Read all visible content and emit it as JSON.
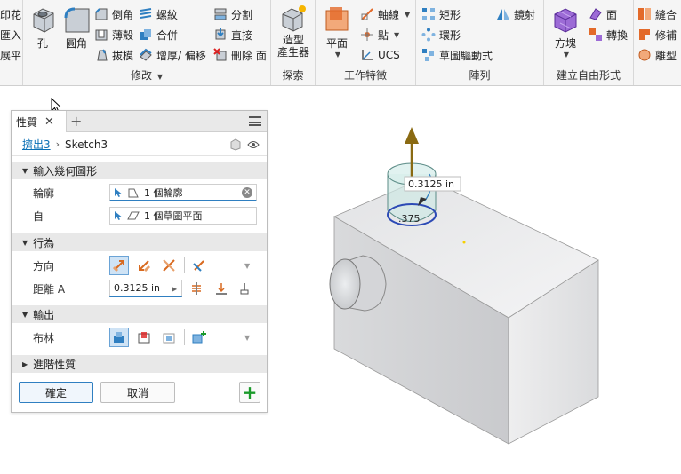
{
  "ribbon": {
    "groups": {
      "modify": {
        "label": "修改"
      },
      "explore": {
        "label": "探索"
      },
      "work_features": {
        "label": "工作特徵"
      },
      "pattern": {
        "label": "陣列"
      },
      "freeform": {
        "label": "建立自由形式"
      }
    },
    "left_partial": [
      "印花",
      "匯入",
      "展平"
    ],
    "modify": {
      "hole": "孔",
      "fillet": "圓角",
      "chamfer": "倒角",
      "shell": "薄殼",
      "draft": "拔模",
      "thread": "螺紋",
      "combine": "合併",
      "thicken": "增厚/ 偏移",
      "split": "分割",
      "direct": "直接",
      "delete_face": "刪除 面"
    },
    "explore": {
      "shape_generator": "造型\n產生器"
    },
    "work": {
      "plane": "平面",
      "axis": "軸線",
      "point": "點",
      "ucs": "UCS"
    },
    "pattern_items": {
      "rect": "矩形",
      "circ": "環形",
      "sketch_driven": "草圖驅動式",
      "mirror": "鏡射"
    },
    "freeform_items": {
      "box": "方塊",
      "face": "面",
      "convert": "轉換"
    },
    "right_partial": [
      "縫合",
      "修補",
      "離型"
    ]
  },
  "panel": {
    "tab_label": "性質",
    "breadcrumb": {
      "feature": "擠出3",
      "sketch": "Sketch3"
    },
    "sections": {
      "input": "輸入幾何圖形",
      "behavior": "行為",
      "output": "輸出",
      "advanced": "進階性質"
    },
    "profile": {
      "label": "輪廓",
      "value": "1 個輪廓"
    },
    "from": {
      "label": "自",
      "value": "1 個草圖平面"
    },
    "direction": {
      "label": "方向"
    },
    "distance": {
      "label": "距離 A",
      "value": "0.3125 in"
    },
    "boolean": {
      "label": "布林"
    },
    "ok": "確定",
    "cancel": "取消"
  },
  "viewport": {
    "dimension_label": "0.3125 in",
    "dimension_small": ".375"
  },
  "colors": {
    "accent": "#2f7fc1",
    "add_green": "#1a9a2a",
    "arrow_gold": "#8a6a12"
  }
}
